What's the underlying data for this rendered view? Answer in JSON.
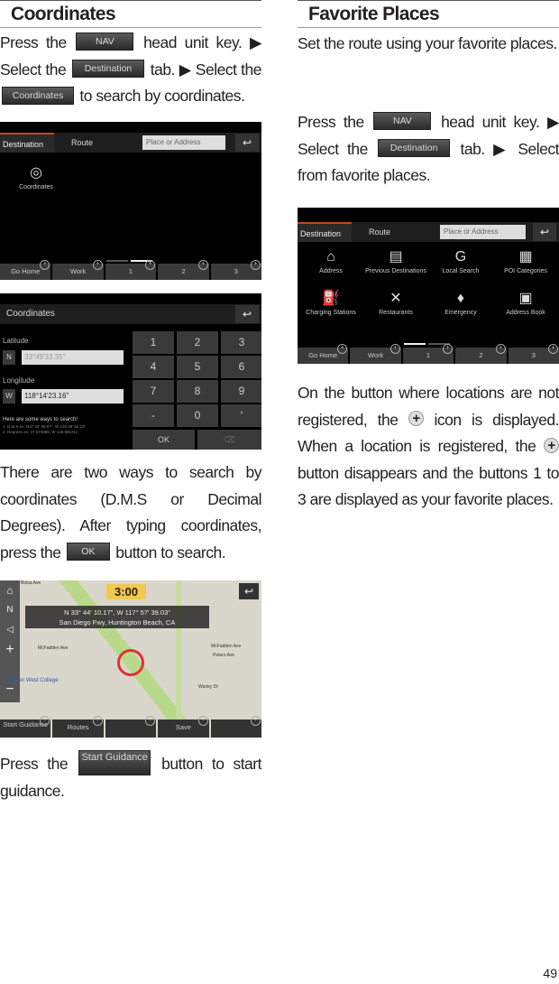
{
  "coordinates": {
    "heading": "Coordinates",
    "step1": {
      "pre": "Press the",
      "nav": "NAV",
      "mid1": "head unit key. ▶ Select the",
      "destination": "Destination",
      "mid2": "tab. ▶ Select the",
      "coordinates": "Coordinates",
      "post": "to search by coordinates."
    },
    "screen1": {
      "tabs": [
        "Destination",
        "Route"
      ],
      "search_placeholder": "Place or Address",
      "item": "Coordinates",
      "favorites": [
        "Go Home",
        "Work",
        "1",
        "2",
        "3"
      ]
    },
    "screen2": {
      "title": "Coordinates",
      "latitude_label": "Latitude",
      "lat_dir": "N",
      "lat_value": "33°49'33.35\"",
      "longitude_label": "Longitude",
      "lon_dir": "W",
      "lon_value": "118°14'23.16\"",
      "hint": "Here are some ways to search!",
      "hint_lines": [
        "1. D.M.S ex: N37 34' 58.87\", W 126 58' 52.23\"",
        "2. Degrees ex: 37.574686, W 126.981211"
      ],
      "keys": [
        "1",
        "2",
        "3",
        "4",
        "5",
        "6",
        "7",
        "8",
        "9",
        "-",
        "0",
        "'"
      ],
      "ok": "OK",
      "delete": "⌫"
    },
    "step2": {
      "pre": "There are two ways to search by coordinates (D.M.S or Decimal Degrees). After typing coordinates, press the",
      "ok": "OK",
      "post": "button to search."
    },
    "screen3": {
      "time": "3:00",
      "coords": "N 33° 44' 10.17\", W 117° 57' 39.03\"",
      "address": "San Diego Fwy, Huntington Beach, CA",
      "streets": [
        "Bolsa Ave",
        "McFadden Ave",
        "Golden West College",
        "Warley Dr",
        "Peters Ave",
        "McFadden Ave"
      ],
      "buttons": [
        "Start Guidance",
        "Routes",
        "",
        "Save",
        ""
      ]
    },
    "step3": {
      "pre": "Press the",
      "start": "Start Guidance",
      "post": "button to start guidance."
    }
  },
  "favorites": {
    "heading": "Favorite Places",
    "intro": "Set the route using your favorite places.",
    "step1": {
      "pre": "Press the",
      "nav": "NAV",
      "mid1": "head unit key. ▶ Select the",
      "destination": "Destination",
      "mid2": "tab. ▶ Select from favorite places."
    },
    "screen": {
      "tabs": [
        "Destination",
        "Route"
      ],
      "search_placeholder": "Place or Address",
      "items": [
        "Address",
        "Previous Destinations",
        "Local Search",
        "POI Categories",
        "Charging Stations",
        "Restaurants",
        "Emergency",
        "Address Book"
      ],
      "favorites": [
        "Go Home",
        "Work",
        "1",
        "2",
        "3"
      ]
    },
    "note": {
      "pre": "On the button where locations are not registered, the",
      "mid": "icon is displayed. When a location is registered, the",
      "post": "button disappears and the buttons 1 to 3 are displayed as your favorite places."
    }
  },
  "page_number": "49",
  "colors": {
    "accent": "#c3461f",
    "screen_bg": "#000000"
  }
}
